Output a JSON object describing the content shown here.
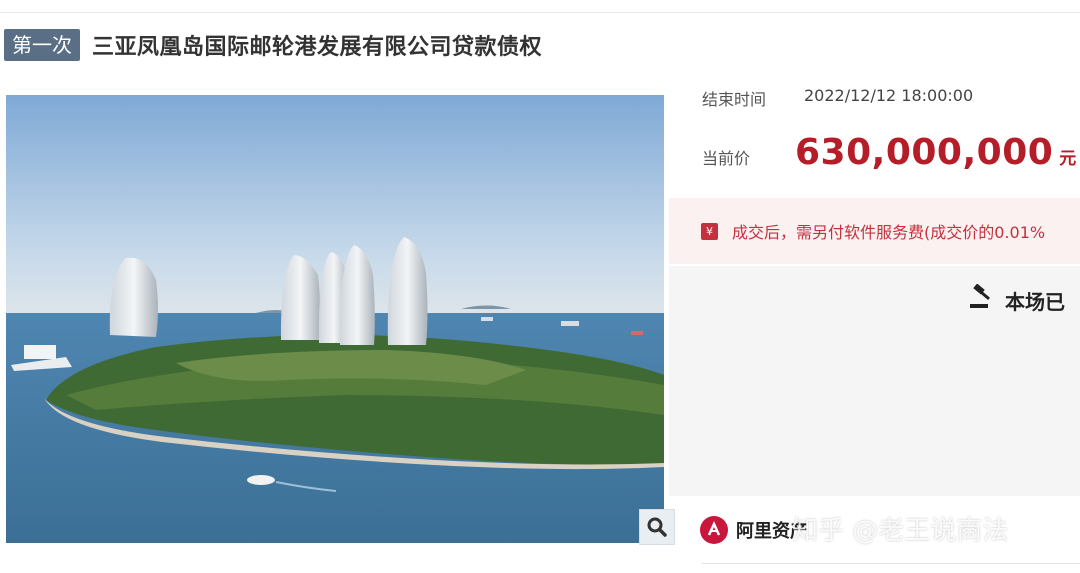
{
  "title": {
    "round_badge": "第一次",
    "text": "三亚凤凰岛国际邮轮港发展有限公司贷款债权"
  },
  "auction_info": {
    "end_time_label": "结束时间",
    "end_time_value": "2022/12/12 18:00:00",
    "price_label": "当前价",
    "price_value": "630,000,000",
    "price_unit": "元",
    "notice_text": "成交后，需另付软件服务费(成交价的0.01%",
    "status_text": "本场已"
  },
  "brand": {
    "name": "阿里资产"
  },
  "watermark": {
    "text": "知乎 @老王说商法"
  },
  "colors": {
    "price_red": "#b51d28",
    "notice_bg": "#fcf1f1",
    "badge_bg": "#5a6f86"
  },
  "icons": {
    "zoom": "magnifier-icon",
    "notice": "ticket-icon",
    "status": "gavel-icon",
    "brand": "ali-logo-icon"
  }
}
